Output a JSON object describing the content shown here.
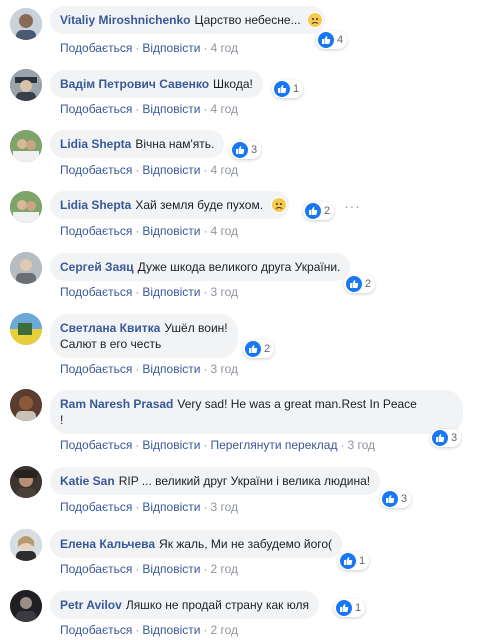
{
  "actions": {
    "like": "Подобається",
    "reply": "Відповісти",
    "translate": "Переглянути переклад"
  },
  "colors": {
    "author": "#385898",
    "bubble": "#f2f3f5",
    "like": "#1877f2",
    "meta": "#90949c"
  },
  "comments": [
    {
      "author": "Vitaliy Miroshnichenko",
      "text": "Царство небесне...",
      "reactions": "4",
      "time": "4 год",
      "emoji": "sad-face-icon"
    },
    {
      "author": "Вадім Петрович Савенко",
      "text": "Шкода!",
      "reactions": "1",
      "time": "4 год"
    },
    {
      "author": "Lidia Shepta",
      "text": "Вічна нам'ять.",
      "reactions": "3",
      "time": "4 год"
    },
    {
      "author": "Lidia Shepta",
      "text": "Хай земля буде пухом.",
      "reactions": "2",
      "time": "4 год",
      "emoji": "sad-face-icon"
    },
    {
      "author": "Сергей Заяц",
      "text": "Дуже шкода великого друга України.",
      "reactions": "2",
      "time": "3 год"
    },
    {
      "author": "Светлана Квитка",
      "text": "Ушёл воин!",
      "text2": "Салют в его честь",
      "reactions": "2",
      "time": "3 год"
    },
    {
      "author": "Ram Naresh Prasad",
      "text": "Very sad! He was a great man.Rest In Peace",
      "text2": "!",
      "reactions": "3",
      "time": "3 год"
    },
    {
      "author": "Katie San",
      "text": "RIP ... великий друг України і велика людина!",
      "reactions": "3",
      "time": "3 год"
    },
    {
      "author": "Елена Кальчева",
      "text": "Як жаль, Ми не забудемо його(",
      "reactions": "1",
      "time": "2 год"
    },
    {
      "author": "Petr Avilov",
      "text": "Ляшко не продай страну как юля",
      "reactions": "1",
      "time": "2 год"
    }
  ]
}
